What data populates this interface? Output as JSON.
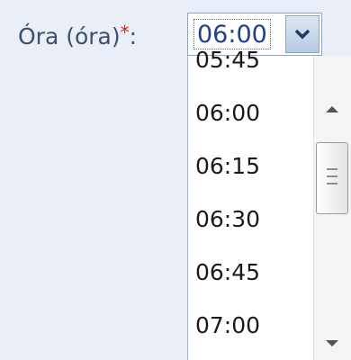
{
  "field": {
    "label": "Óra (óra)",
    "required_mark": "*",
    "colon": ":"
  },
  "combo": {
    "selected_value": "06:00",
    "button_icon": "chevron-down-icon"
  },
  "dropdown": {
    "options": [
      "05:45",
      "06:00",
      "06:15",
      "06:30",
      "06:45",
      "07:00"
    ]
  },
  "scrollbar": {
    "up_icon": "scroll-up-arrow-icon",
    "down_icon": "scroll-down-arrow-icon",
    "thumb_icon": "grip-icon"
  },
  "colors": {
    "background": "#e9eef7",
    "label_text": "#3b4f6e",
    "required": "#d11f1f",
    "selected_text": "#1f3f8f",
    "border": "#8aa6c7"
  }
}
